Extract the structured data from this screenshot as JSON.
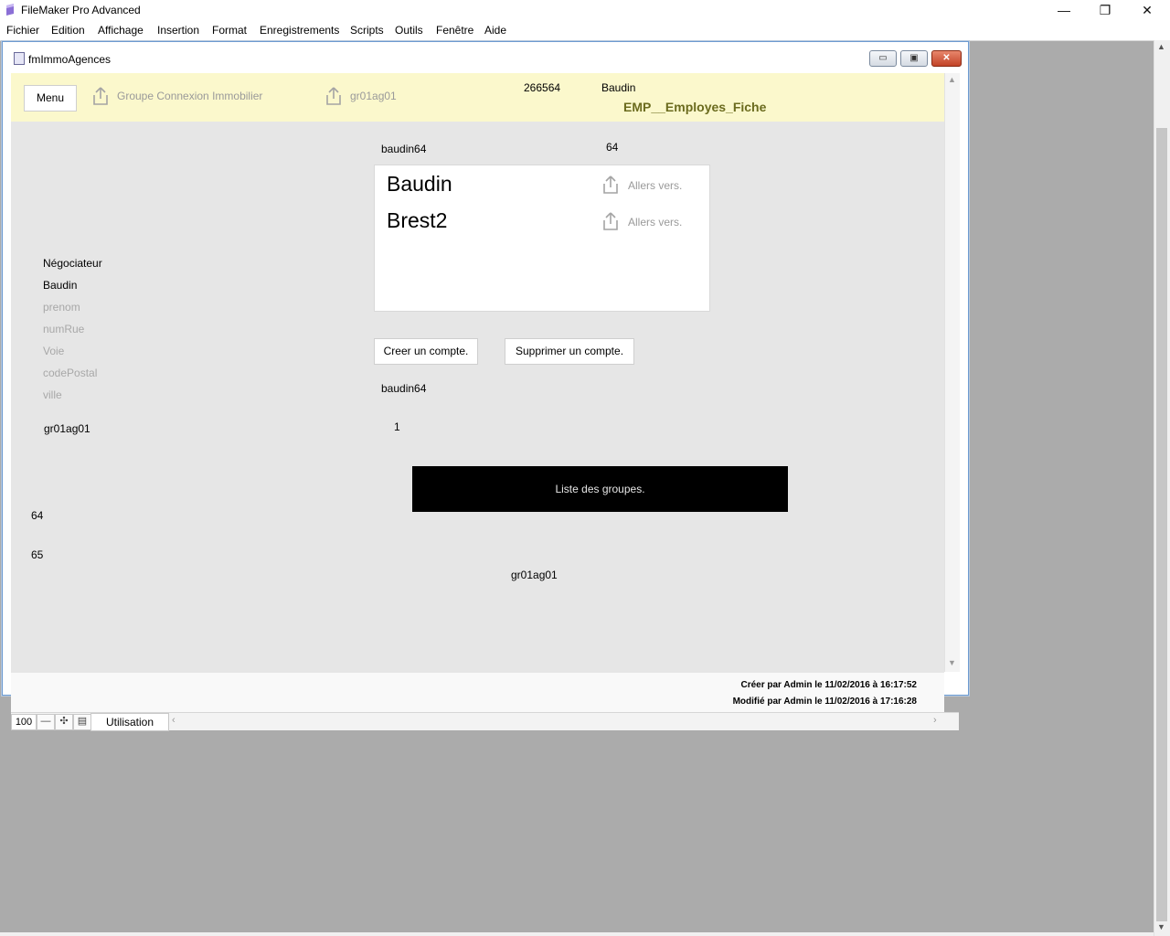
{
  "app": {
    "title": "FileMaker Pro Advanced",
    "controls": {
      "minimize": "—",
      "restore": "❐",
      "close": "✕"
    }
  },
  "menubar": {
    "items": [
      "Fichier",
      "Edition",
      "Affichage",
      "Insertion",
      "Format",
      "Enregistrements",
      "Scripts",
      "Outils",
      "Fenêtre",
      "Aide"
    ]
  },
  "window": {
    "title": "fmImmoAgences",
    "controls": {
      "minimize": "▭",
      "restore": "▣",
      "close": "✕"
    }
  },
  "header": {
    "menu_label": "Menu",
    "group_link": "Groupe Connexion Immobilier",
    "group_code": "gr01ag01",
    "record_id": "266564",
    "user_name": "Baudin",
    "layout_name": "EMP__Employes_Fiche"
  },
  "body": {
    "login_top": "baudin64",
    "number_top": "64",
    "card_rows": [
      {
        "name": "Baudin",
        "action": "Allers vers."
      },
      {
        "name": "Brest2",
        "action": "Allers vers."
      }
    ],
    "fields": {
      "role": "Négociateur",
      "nom": "Baudin",
      "prenom_placeholder": "prenom",
      "numrue_placeholder": "numRue",
      "voie_placeholder": "Voie",
      "codepostal_placeholder": "codePostal",
      "ville_placeholder": "ville",
      "group_code": "gr01ag01"
    },
    "create_account_label": "Creer un compte.",
    "delete_account_label": "Supprimer un compte.",
    "login_bottom": "baudin64",
    "count": "1",
    "groups_button_label": "Liste des groupes.",
    "num_a": "64",
    "num_b": "65",
    "bottom_group_code": "gr01ag01"
  },
  "footer": {
    "created": "Créer par Admin le 11/02/2016 à 16:17:52",
    "modified": "Modifié par Admin le 11/02/2016 à 17:16:28"
  },
  "statusbar": {
    "zoom": "100",
    "zoom_out": "—",
    "zoom_in": "✣",
    "toggle": "▤",
    "mode": "Utilisation",
    "left_arrow": "‹",
    "right_arrow": "›"
  }
}
